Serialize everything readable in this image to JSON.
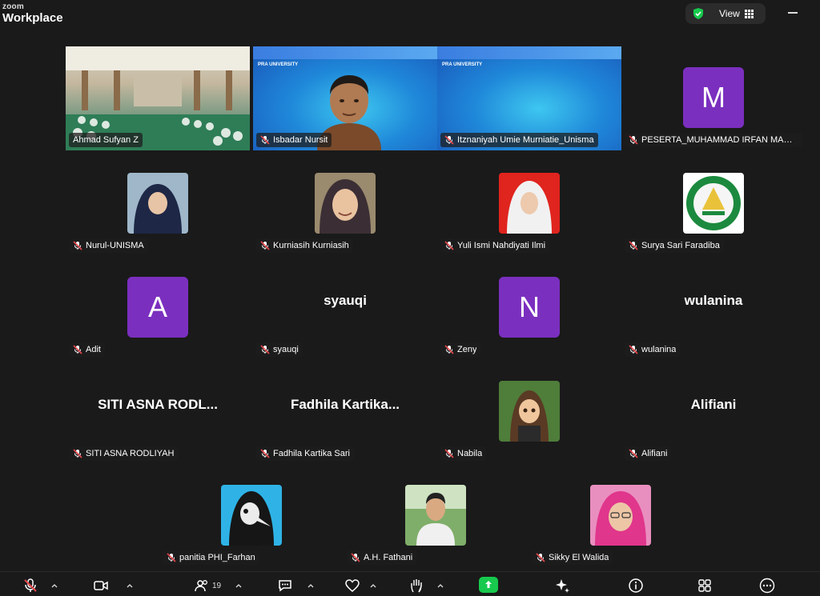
{
  "app": {
    "brand_top": "zoom",
    "brand_bottom": "Workplace",
    "view_label": "View",
    "accent": "#3dd68c",
    "avatar_purple": "#7b2fbf",
    "share_green": "#17c94d"
  },
  "participants": [
    {
      "name": "Ahmad Sufyan Z",
      "label": "",
      "muted": false
    },
    {
      "name": "Isbadar Nursit",
      "label": "",
      "muted": true
    },
    {
      "name": "Itznaniyah Umie Murniatie_Unisma",
      "label": "",
      "muted": true
    },
    {
      "name": "PESERTA_MUHAMMAD IRFAN MAUL...",
      "label": "M",
      "muted": true
    },
    {
      "name": "Nurul-UNISMA",
      "label": "",
      "muted": true
    },
    {
      "name": "Kurniasih Kurniasih",
      "label": "",
      "muted": true
    },
    {
      "name": "Yuli Ismi Nahdiyati Ilmi",
      "label": "",
      "muted": true
    },
    {
      "name": "Surya Sari Faradiba",
      "label": "",
      "muted": true
    },
    {
      "name": "Adit",
      "label": "A",
      "muted": true
    },
    {
      "name": "syauqi",
      "label": "syauqi",
      "muted": true
    },
    {
      "name": "Zeny",
      "label": "N",
      "muted": true
    },
    {
      "name": "wulanina",
      "label": "wulanina",
      "muted": true
    },
    {
      "name": "SITI ASNA RODLIYAH",
      "label": "SITI  ASNA  RODL...",
      "muted": true
    },
    {
      "name": "Fadhila Kartika Sari",
      "label": "Fadhila  Kartika...",
      "muted": true
    },
    {
      "name": "Nabila",
      "label": "",
      "muted": true
    },
    {
      "name": "Alifiani",
      "label": "Alifiani",
      "muted": true
    },
    {
      "name": "panitia PHI_Farhan",
      "label": "",
      "muted": true
    },
    {
      "name": "A.H. Fathani",
      "label": "",
      "muted": true
    },
    {
      "name": "Sikky El Walida",
      "label": "",
      "muted": true
    }
  ],
  "slide": {
    "title": "PRA UNIVERSITY"
  },
  "toolbar": {
    "participants_count": "19",
    "icons": [
      "mic-off-icon",
      "video-icon",
      "participants-icon",
      "chat-icon",
      "reactions-icon",
      "raise-hand-icon",
      "share-screen-icon",
      "ai-companion-icon",
      "info-icon",
      "apps-icon",
      "more-icon"
    ]
  }
}
